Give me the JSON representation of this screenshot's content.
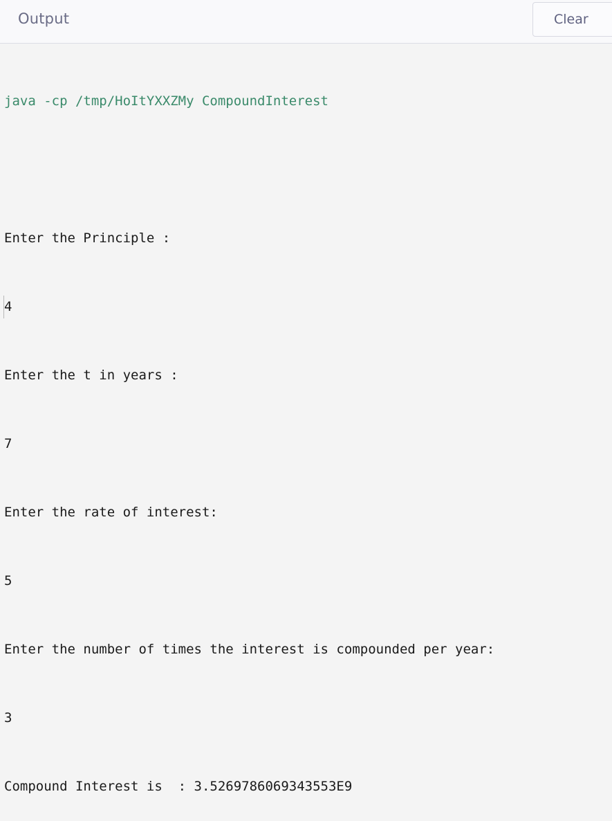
{
  "header": {
    "title": "Output",
    "clear_label": "Clear"
  },
  "console": {
    "command": "java -cp /tmp/HoItYXXZMy CompoundInterest",
    "lines": [
      "Enter the Principle :",
      "4",
      "Enter the t in years :",
      "7",
      "Enter the rate of interest:",
      "5",
      "Enter the number of times the interest is compounded per year:",
      "3",
      "Compound Interest is  : 3.526978606934355 3E9"
    ]
  },
  "colors": {
    "command_text": "#3a8a6a",
    "output_text": "#1a1a1a",
    "header_text": "#6a6c86",
    "background": "#f4f4f4"
  }
}
